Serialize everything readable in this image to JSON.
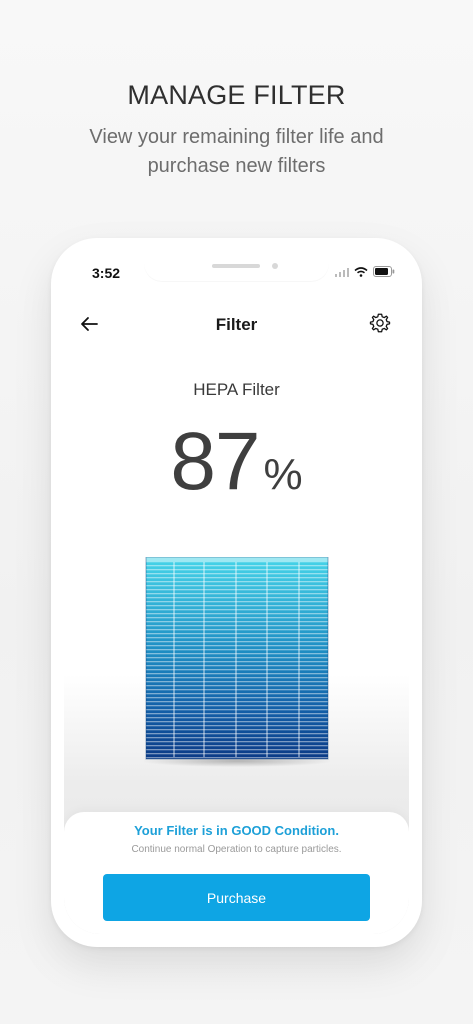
{
  "promo": {
    "title": "MANAGE FILTER",
    "subtitle": "View your remaining filter life and purchase new filters"
  },
  "status_bar": {
    "time": "3:52",
    "icons": [
      "signal-icon",
      "wifi-icon",
      "battery-icon"
    ]
  },
  "nav": {
    "title": "Filter",
    "back_icon": "back-arrow-icon",
    "settings_icon": "gear-icon"
  },
  "filter": {
    "name": "HEPA Filter",
    "remaining_value": "87",
    "remaining_unit": "%"
  },
  "condition": {
    "title": "Your Filter is in GOOD Condition.",
    "subtitle": "Continue normal Operation to capture particles."
  },
  "actions": {
    "purchase_label": "Purchase"
  },
  "colors": {
    "accent": "#0ea5e4",
    "condition_text": "#1da0d8",
    "filter_top": "#3fd0e6",
    "filter_bottom": "#0b3f8a"
  }
}
